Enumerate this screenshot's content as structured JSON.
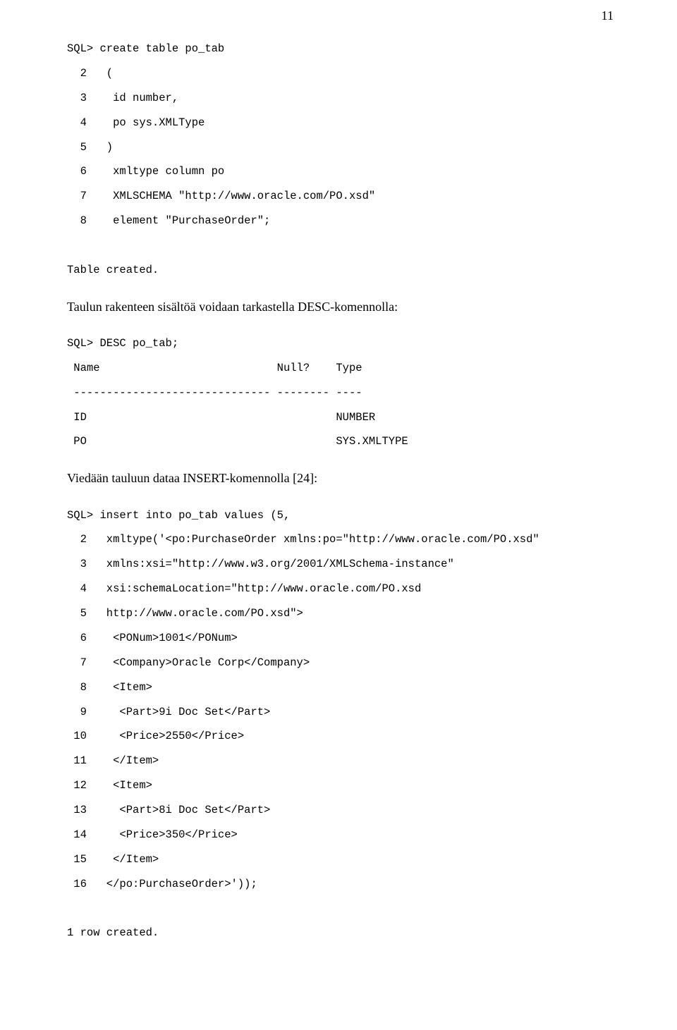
{
  "pageNumber": "11",
  "code1": "SQL> create table po_tab\n  2   (\n  3    id number,\n  4    po sys.XMLType\n  5   )\n  6    xmltype column po\n  7    XMLSCHEMA \"http://www.oracle.com/PO.xsd\"\n  8    element \"PurchaseOrder\";\n\nTable created.",
  "prose1": "Taulun rakenteen sisältöä voidaan tarkastella DESC-komennolla:",
  "code2": "SQL> DESC po_tab;\n Name                           Null?    Type\n ------------------------------ -------- ----\n ID                                      NUMBER\n PO                                      SYS.XMLTYPE",
  "prose2": "Viedään tauluun dataa INSERT-komennolla [24]:",
  "code3": "SQL> insert into po_tab values (5,\n  2   xmltype('<po:PurchaseOrder xmlns:po=\"http://www.oracle.com/PO.xsd\"\n  3   xmlns:xsi=\"http://www.w3.org/2001/XMLSchema-instance\"\n  4   xsi:schemaLocation=\"http://www.oracle.com/PO.xsd\n  5   http://www.oracle.com/PO.xsd\">\n  6    <PONum>1001</PONum>\n  7    <Company>Oracle Corp</Company>\n  8    <Item>\n  9     <Part>9i Doc Set</Part>\n 10     <Price>2550</Price>\n 11    </Item>\n 12    <Item>\n 13     <Part>8i Doc Set</Part>\n 14     <Price>350</Price>\n 15    </Item>\n 16   </po:PurchaseOrder>'));\n\n1 row created."
}
